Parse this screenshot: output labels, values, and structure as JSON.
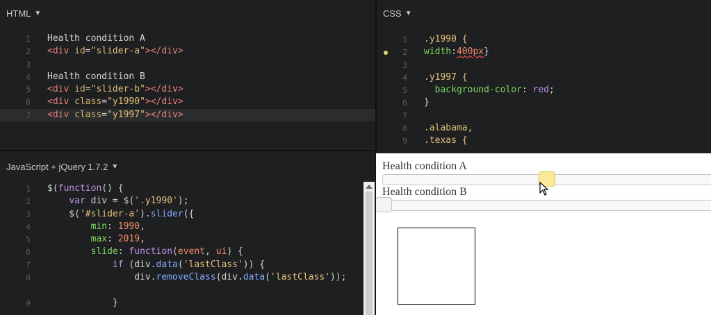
{
  "html_pane": {
    "title": "HTML",
    "lines": [
      {
        "n": "1",
        "text": "Health condition A"
      },
      {
        "n": "2",
        "text": "<div id=\"slider-a\"></div>"
      },
      {
        "n": "3",
        "text": ""
      },
      {
        "n": "4",
        "text": "Health condition B"
      },
      {
        "n": "5",
        "text": "<div id=\"slider-b\"></div>"
      },
      {
        "n": "6",
        "text": "<div class=\"y1990\"></div>"
      },
      {
        "n": "7",
        "text": "<div class=\"y1997\"></div>"
      }
    ]
  },
  "css_pane": {
    "title": "CSS",
    "lines": [
      {
        "n": "1",
        "text": ".y1990 {"
      },
      {
        "n": "2",
        "text": "width:400px}"
      },
      {
        "n": "3",
        "text": ""
      },
      {
        "n": "4",
        "text": ".y1997 {"
      },
      {
        "n": "5",
        "text": "  background-color: red;"
      },
      {
        "n": "6",
        "text": "}"
      },
      {
        "n": "7",
        "text": ""
      },
      {
        "n": "8",
        "text": ".alabama,"
      },
      {
        "n": "9",
        "text": ".texas {"
      }
    ]
  },
  "js_pane": {
    "title": "JavaScript + jQuery 1.7.2",
    "lines": [
      {
        "n": "1",
        "text": "$(function() {"
      },
      {
        "n": "2",
        "text": "    var div = $('.y1990');"
      },
      {
        "n": "3",
        "text": "    $('#slider-a').slider({"
      },
      {
        "n": "4",
        "text": "        min: 1990,"
      },
      {
        "n": "5",
        "text": "        max: 2019,"
      },
      {
        "n": "6",
        "text": "        slide: function(event, ui) {"
      },
      {
        "n": "7",
        "text": "            if (div.data('lastClass')) {"
      },
      {
        "n": "8",
        "text": "                div.removeClass(div.data('lastClass'));"
      },
      {
        "n": "9",
        "text": "            }"
      }
    ]
  },
  "result_pane": {
    "label_a": "Health condition A",
    "label_b": "Health condition B",
    "slider_a_value": 0.5,
    "slider_b_value": 0
  },
  "colors": {
    "editor_bg": "#1d1f20",
    "handle_active": "#fbe99a",
    "gutter_dot": "#e2d06a"
  }
}
